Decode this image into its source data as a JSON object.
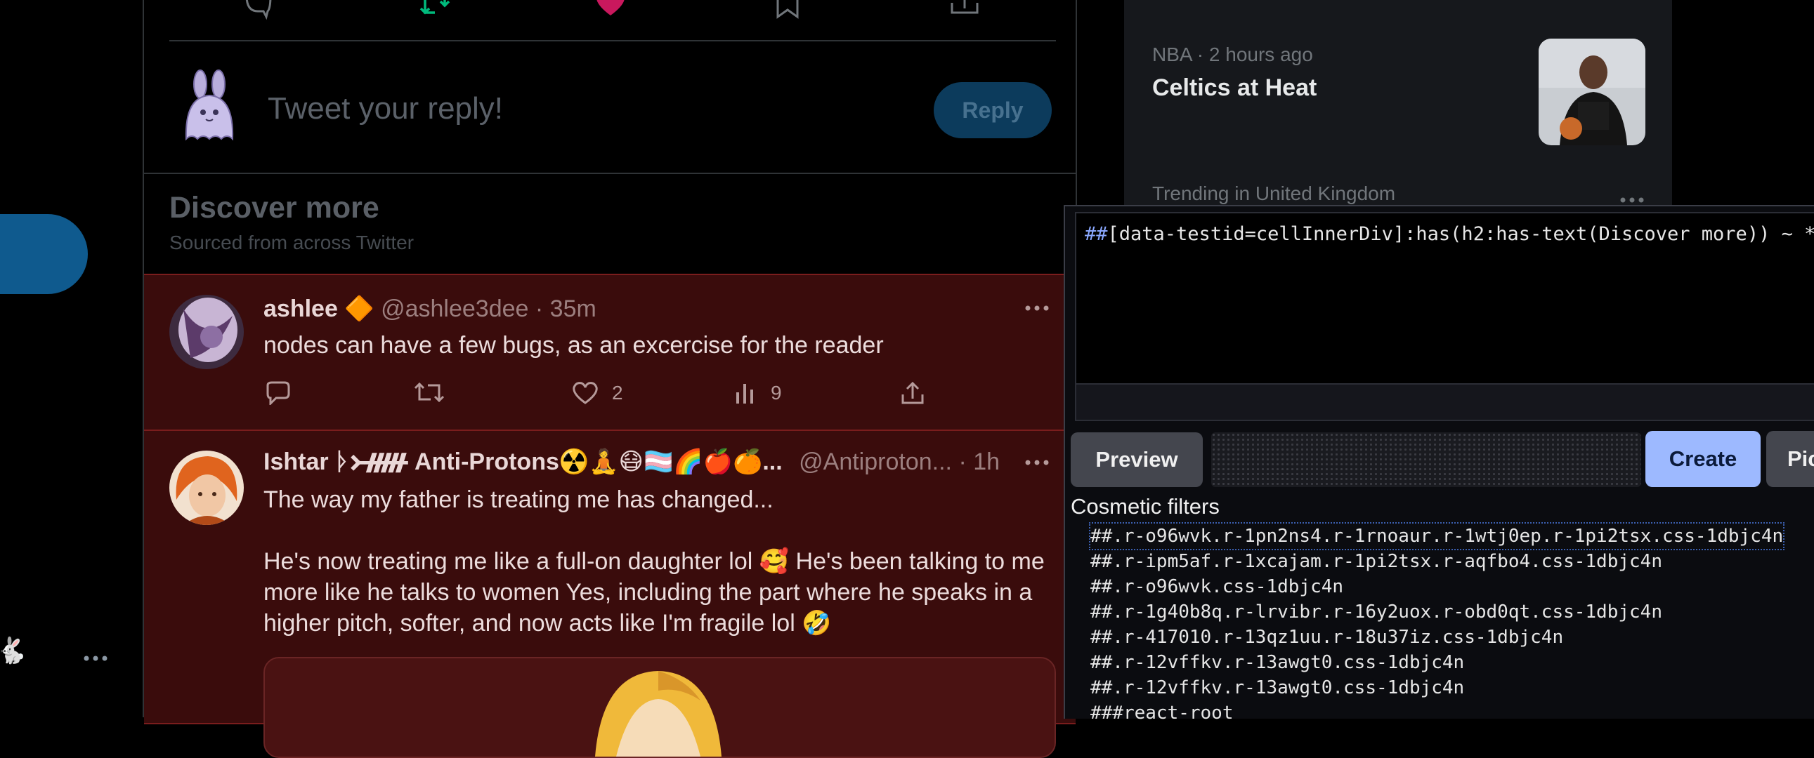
{
  "left_nav": {
    "emoji": "🐇",
    "more_icon": "ellipsis-icon"
  },
  "timeline": {
    "action_icons": [
      "reply-icon",
      "retweet-icon",
      "like-icon",
      "bookmark-icon",
      "share-icon"
    ],
    "reply_box": {
      "placeholder": "Tweet your reply!",
      "button_label": "Reply"
    },
    "discover": {
      "title": "Discover more",
      "subtitle": "Sourced from across Twitter"
    },
    "tweets": [
      {
        "name": "ashlee 🔶",
        "handle": "@ashlee3dee",
        "time": "· 35m",
        "text": "nodes can have a few bugs, as an excercise for the reader",
        "likes": "2",
        "views": "9"
      },
      {
        "name": "Ishtar ᚦ᚛ᚏ Anti-Protons☢️🧘😷🏳️‍⚧️🌈🍎🍊...",
        "handle": "@Antiproton...",
        "time": "· 1h",
        "text_line1": "The way my father is treating me has changed...",
        "text_line2": "He's now treating me like a full-on daughter lol 🥰 He's been talking to me",
        "text_line3": "more like he talks to women Yes, including the part where he speaks in a",
        "text_line4": "higher pitch, softer, and now acts like I'm fragile lol 🤣"
      }
    ]
  },
  "trending": {
    "meta": "NBA · 2 hours ago",
    "title": "Celtics at Heat",
    "next_meta": "Trending in United Kingdom"
  },
  "picker": {
    "filter_prefix": "##",
    "filter_rest": "[data-testid=cellInnerDiv]:has(h2:has-text(Discover more)) ~ *",
    "preview_label": "Preview",
    "create_label": "Create",
    "pick_label": "Pick",
    "cosmetic_title": "Cosmetic filters",
    "cosmetic_filters": [
      "##.r-o96wvk.r-1pn2ns4.r-1rnoaur.r-1wtj0ep.r-1pi2tsx.css-1dbjc4n",
      "##.r-ipm5af.r-1xcajam.r-1pi2tsx.r-aqfbo4.css-1dbjc4n",
      "##.r-o96wvk.css-1dbjc4n",
      "##.r-1g40b8q.r-lrvibr.r-16y2uox.r-obd0qt.css-1dbjc4n",
      "##.r-417010.r-13qz1uu.r-18u37iz.css-1dbjc4n",
      "##.r-12vffkv.r-13awgt0.css-1dbjc4n",
      "##.r-12vffkv.r-13awgt0.css-1dbjc4n",
      "###react-root"
    ]
  },
  "colors": {
    "accent_blue": "#1d9bf0",
    "tweet_highlight": "#3a0c0c",
    "create_button": "#9db9ff"
  }
}
